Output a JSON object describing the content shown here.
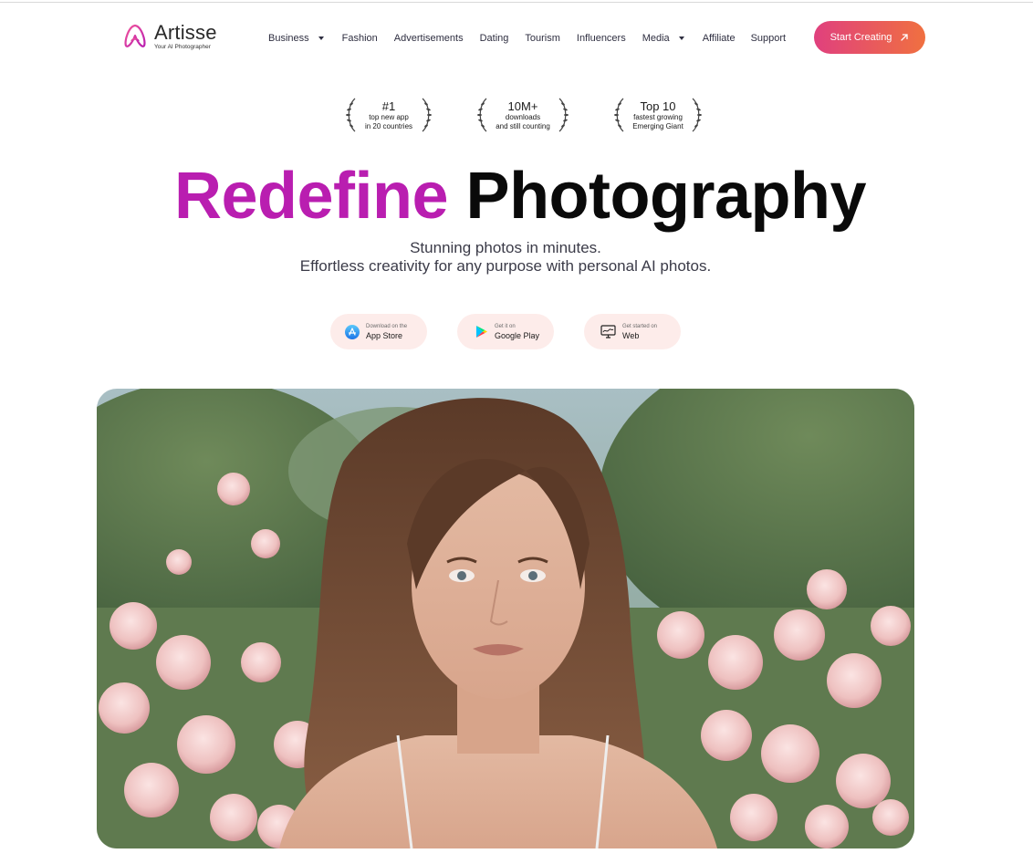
{
  "header": {
    "logo_name": "Artisse",
    "logo_tagline": "Your AI Photographer",
    "nav": [
      {
        "label": "Business",
        "has_dropdown": true
      },
      {
        "label": "Fashion",
        "has_dropdown": false
      },
      {
        "label": "Advertisements",
        "has_dropdown": false
      },
      {
        "label": "Dating",
        "has_dropdown": false
      },
      {
        "label": "Tourism",
        "has_dropdown": false
      },
      {
        "label": "Influencers",
        "has_dropdown": false
      },
      {
        "label": "Media",
        "has_dropdown": true
      },
      {
        "label": "Affiliate",
        "has_dropdown": false
      },
      {
        "label": "Support",
        "has_dropdown": false
      }
    ],
    "cta_label": "Start Creating",
    "cta_icon": "arrow-up-right-icon"
  },
  "awards": [
    {
      "big": "#1",
      "line1": "top new app",
      "line2": "in 20 countries"
    },
    {
      "big": "10M+",
      "line1": "downloads",
      "line2": "and still counting"
    },
    {
      "big": "Top 10",
      "line1": "fastest growing",
      "line2": "Emerging Giant"
    }
  ],
  "hero": {
    "headline_accent": "Redefine",
    "headline_rest": "Photography",
    "subtitle_line1": "Stunning photos in minutes.",
    "subtitle_line2": "Effortless creativity for any purpose with personal AI photos."
  },
  "stores": [
    {
      "small": "Download on the",
      "big": "App Store",
      "icon": "app-store-icon"
    },
    {
      "small": "Get it on",
      "big": "Google Play",
      "icon": "google-play-icon"
    },
    {
      "small": "Get started on",
      "big": "Web",
      "icon": "web-monitor-icon"
    }
  ],
  "colors": {
    "accent_magenta": "#b91eb0",
    "cta_gradient_start": "#e0407e",
    "cta_gradient_end": "#f07040",
    "store_button_bg": "#fdecea"
  }
}
